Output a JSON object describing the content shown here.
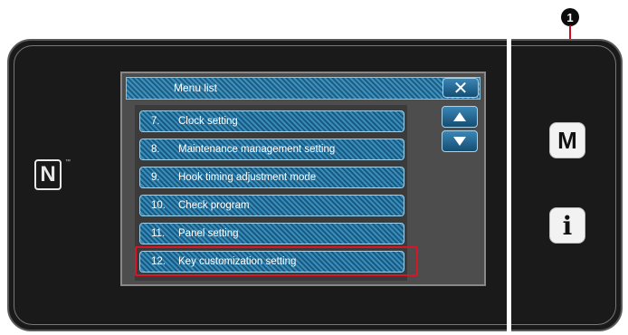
{
  "callout": {
    "number": "1"
  },
  "screen": {
    "title": "Menu list",
    "close_label": "✕"
  },
  "menu_items": [
    {
      "number": "7.",
      "label": "Clock setting"
    },
    {
      "number": "8.",
      "label": "Maintenance management setting"
    },
    {
      "number": "9.",
      "label": "Hook timing adjustment mode"
    },
    {
      "number": "10.",
      "label": "Check program"
    },
    {
      "number": "11.",
      "label": "Panel setting"
    },
    {
      "number": "12.",
      "label": "Key customization setting"
    }
  ],
  "hard_keys": {
    "mode_label": "M",
    "info_label": "i"
  },
  "nfc": {
    "label": "N",
    "tm": "™"
  },
  "colors": {
    "highlight": "#d6172a",
    "button_blue": "#2a6f9a",
    "callout_line": "#c8101f"
  }
}
